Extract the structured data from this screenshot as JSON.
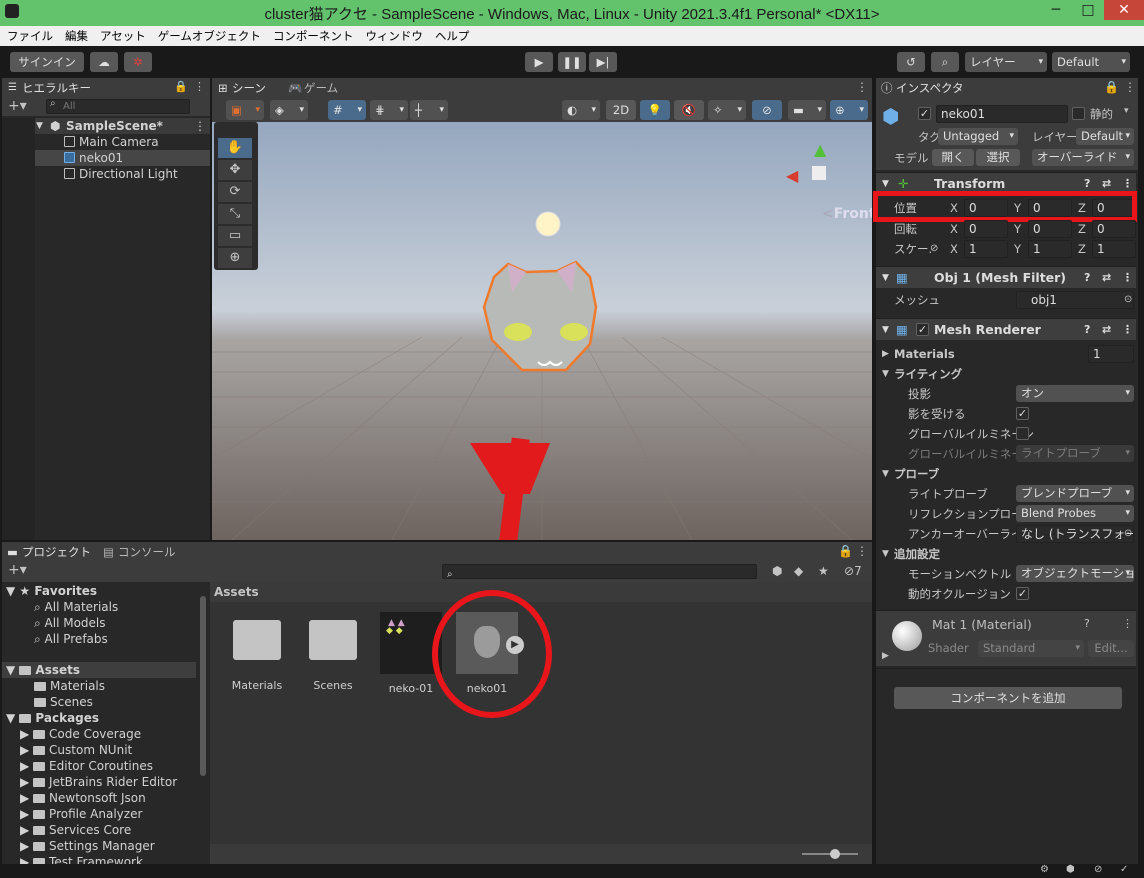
{
  "window": {
    "title": "cluster猫アクセ - SampleScene - Windows, Mac, Linux - Unity 2021.3.4f1 Personal* <DX11>"
  },
  "menu": [
    "ファイル",
    "編集",
    "アセット",
    "ゲームオブジェクト",
    "コンポーネント",
    "ウィンドウ",
    "ヘルプ"
  ],
  "toolbar": {
    "signin": "サインイン",
    "layers": "レイヤー",
    "layout": "Default"
  },
  "hierarchy": {
    "tab": "ヒエラルキー",
    "search_placeholder": "All",
    "scene": "SampleScene*",
    "items": [
      "Main Camera",
      "neko01",
      "Directional Light"
    ]
  },
  "scene_view": {
    "tab_scene": "シーン",
    "tab_game": "ゲーム",
    "mode_2d": "2D",
    "gizmo_label": "Front"
  },
  "project": {
    "tab_project": "プロジェクト",
    "tab_console": "コンソール",
    "favorites_label": "Favorites",
    "favorites": [
      "All Materials",
      "All Models",
      "All Prefabs"
    ],
    "assets_label": "Assets",
    "asset_folders": [
      "Materials",
      "Scenes"
    ],
    "packages_label": "Packages",
    "packages": [
      "Code Coverage",
      "Custom NUnit",
      "Editor Coroutines",
      "JetBrains Rider Editor",
      "Newtonsoft Json",
      "Profile Analyzer",
      "Services Core",
      "Settings Manager",
      "Test Framework"
    ],
    "breadcrumb": "Assets",
    "hidden_count": "7",
    "grid_items": [
      "Materials",
      "Scenes",
      "neko-01",
      "neko01"
    ]
  },
  "inspector": {
    "tab": "インスペクター",
    "object_name": "neko01",
    "static_label": "静的",
    "tag_label": "タグ",
    "tag_value": "Untagged",
    "layer_label": "レイヤー",
    "layer_value": "Default",
    "model_label": "モデル",
    "open_button": "開く",
    "select_button": "選択",
    "override_button": "オーバーライド",
    "transform": {
      "title": "Transform",
      "position_label": "位置",
      "rotation_label": "回転",
      "scale_label": "スケー.",
      "position": {
        "x": "0",
        "y": "0",
        "z": "0"
      },
      "rotation": {
        "x": "0",
        "y": "0",
        "z": "0"
      },
      "scale": {
        "x": "1",
        "y": "1",
        "z": "1"
      }
    },
    "mesh_filter": {
      "title": "Obj 1 (Mesh Filter)",
      "mesh_label": "メッシュ",
      "mesh_value": "obj1"
    },
    "mesh_renderer": {
      "title": "Mesh Renderer",
      "materials_label": "Materials",
      "materials_count": "1",
      "lighting_label": "ライティング",
      "cast_shadows_label": "投影",
      "cast_shadows_value": "オン",
      "receive_shadows_label": "影を受ける",
      "gi_label": "グローバルイルミネーシ",
      "gi_label2": "グローバルイルミネーシ",
      "gi_value": "ライトプローブ",
      "probes_label": "プローブ",
      "light_probes_label": "ライトプローブ",
      "light_probes_value": "ブレンドプローブ",
      "reflection_label": "リフレクションプローブ",
      "reflection_value": "Blend Probes",
      "anchor_label": "アンカーオーバーライド",
      "anchor_value": "なし (トランスフォーム",
      "additional_label": "追加設定",
      "motion_label": "モーションベクトル",
      "motion_value": "オブジェクトモーションこ",
      "dynamic_label": "動的オクルージョン"
    },
    "material": {
      "title": "Mat 1 (Material)",
      "shader_label": "Shader",
      "shader_value": "Standard",
      "edit_button": "Edit..."
    },
    "add_component": "コンポーネントを追加"
  },
  "colors": {
    "highlight_red": "#e8151b",
    "title_green": "#63c26c",
    "selection_orange": "#f07a2c"
  }
}
